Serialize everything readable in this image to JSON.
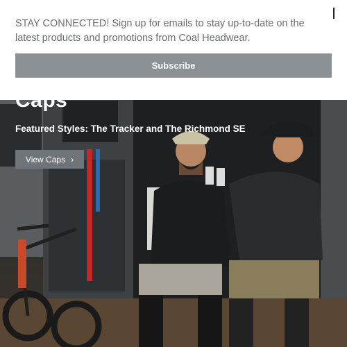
{
  "signup": {
    "message": "STAY CONNECTED! Sign up for emails to stay up-to-date on the latest products and promotions from Coal Headwear.",
    "subscribe_label": "Subscribe",
    "close_icon": "close-icon"
  },
  "hero": {
    "title": "Caps",
    "subtitle": "Featured Styles: The Tracker and The Richmond SE",
    "button_label": "View Caps",
    "button_icon": "chevron-right-icon"
  },
  "colors": {
    "subscribe_bg": "#8c9196",
    "hero_button_bg": "#6f7478",
    "signup_text": "#6b6e70"
  }
}
